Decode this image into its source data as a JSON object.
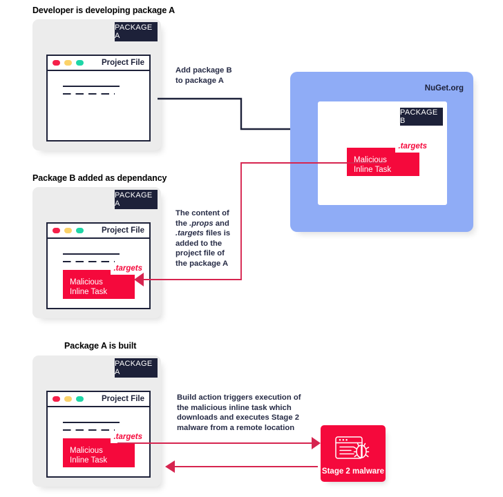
{
  "diagram": {
    "title": "NuGet malicious package dependency attack flow",
    "colors": {
      "dark": "#1d2139",
      "red": "#f5093c",
      "blue": "#8facf6",
      "card_grey": "#ececec",
      "arrow_red": "#d6244f"
    }
  },
  "sections": [
    {
      "heading": "Developer is developing package A",
      "package_tag": "PACKAGE A",
      "window_title": "Project File",
      "has_malicious": false
    },
    {
      "heading": "Package B added as dependancy",
      "package_tag": "PACKAGE A",
      "window_title": "Project File",
      "has_malicious": true
    },
    {
      "heading": "Package A is built",
      "package_tag": "PACKAGE A",
      "window_title": "Project File",
      "has_malicious": true
    }
  ],
  "malicious_block": {
    "line1": "Malicious",
    "line2": "Inline Task",
    "chip": ".targets"
  },
  "nuget": {
    "label": "NuGet.org",
    "package_tag": "PACKAGE B",
    "malicious": {
      "line1": "Malicious",
      "line2": "Inline Task",
      "chip": ".targets"
    }
  },
  "notes": {
    "add_package": "Add package B\nto package A",
    "add_package_line1": "Add package B",
    "add_package_line2": "to package A",
    "content_of": {
      "l1": "The content of",
      "l2_pre": "the ",
      "l2_em": ".props",
      "l2_post": " and",
      "l3_em": ".targets",
      "l3_post": " files is",
      "l4": "added to the",
      "l5": "project file of",
      "l6": "the package A"
    },
    "build_action": {
      "l1": "Build action triggers execution of",
      "l2": "the malicious inline task which",
      "l3": "downloads and executes Stage 2",
      "l4": "malware from a remote location"
    }
  },
  "stage2": {
    "label": "Stage 2 malware",
    "icon": "browser-bug-icon"
  }
}
